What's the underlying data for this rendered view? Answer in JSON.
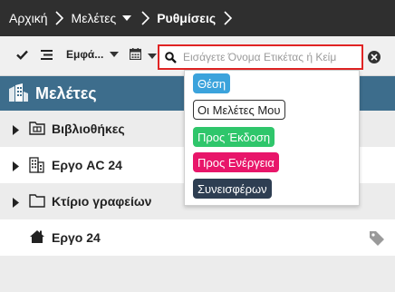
{
  "breadcrumb": {
    "home": "Αρχική",
    "projects": "Μελέτες",
    "settings": "Ρυθμίσεις"
  },
  "toolbar": {
    "view_label": "Εμφά...",
    "search_placeholder": "Εισάγετε Όνομα Ετικέτας ή Κείμ"
  },
  "tree": {
    "title": "Μελέτες",
    "items": [
      {
        "label": "Βιβλιοθήκες",
        "icon": "library-folder-icon",
        "expandable": true
      },
      {
        "label": "Εργο AC 24",
        "icon": "building-icon",
        "expandable": true
      },
      {
        "label": "Κτίριο γραφείων",
        "icon": "folder-icon",
        "expandable": true
      },
      {
        "label": "Εργο 24",
        "icon": "house-icon",
        "expandable": false
      }
    ]
  },
  "tags": [
    {
      "label": "Θέση",
      "color": "#3ba3dc"
    },
    {
      "label": "Οι Μελέτες Μου",
      "color": "#ffffff"
    },
    {
      "label": "Προς Έκδοση",
      "color": "#2fc66b"
    },
    {
      "label": "Προς Ενέργεια",
      "color": "#e8166a"
    },
    {
      "label": "Συνεισφέρων",
      "color": "#2e3e52"
    }
  ],
  "colors": {
    "topbar": "#2f2f2f",
    "tree_header": "#3d6d8c",
    "search_highlight": "#e02424"
  }
}
